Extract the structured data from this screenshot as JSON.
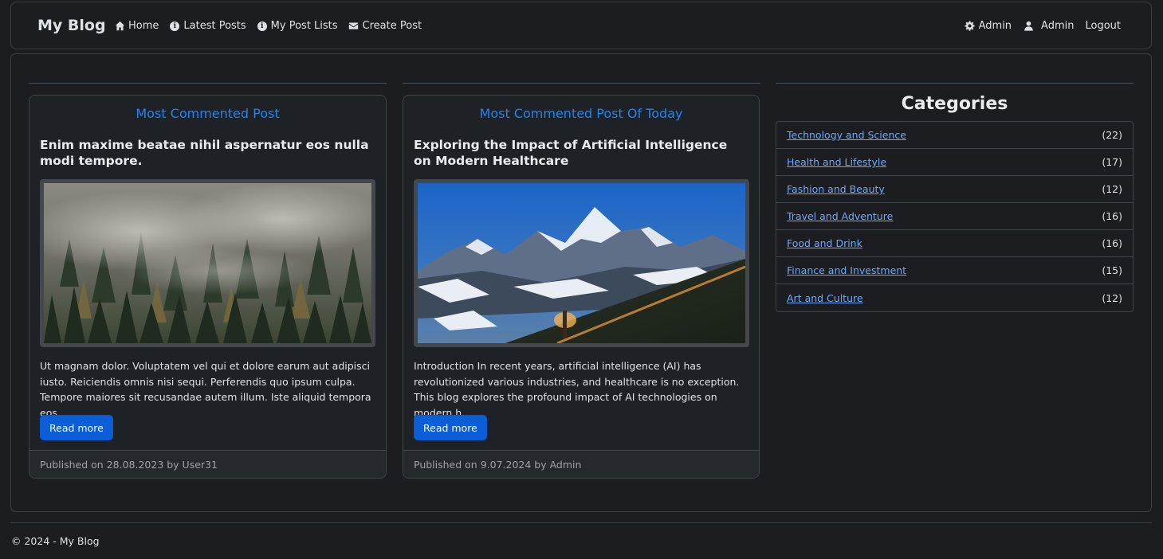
{
  "navbar": {
    "brand": "My Blog",
    "left_links": [
      {
        "label": "Home",
        "icon": "home-icon"
      },
      {
        "label": "Latest Posts",
        "icon": "info-icon"
      },
      {
        "label": "My Post Lists",
        "icon": "info-icon"
      },
      {
        "label": "Create Post",
        "icon": "envelope-icon"
      }
    ],
    "right_links": [
      {
        "label": "Admin",
        "icon": "gear-icon"
      },
      {
        "label": "Admin",
        "icon": "user-icon"
      },
      {
        "label": "Logout"
      }
    ]
  },
  "cards": [
    {
      "heading": "Most Commented Post",
      "title": "Enim maxime beatae nihil aspernatur eos nulla modi tempore.",
      "image": "foggy-forest-image",
      "excerpt": "Ut magnam dolor. Voluptatem vel qui et dolore earum aut adipisci iusto. Reiciendis omnis nisi sequi. Perferendis quo ipsum culpa. Tempore maiores sit recusandae autem illum. Iste aliquid tempora eos ...",
      "button": "Read more",
      "footer": "Published on 28.08.2023 by User31"
    },
    {
      "heading": "Most Commented Post Of Today",
      "title": "Exploring the Impact of Artificial Intelligence on Modern Healthcare",
      "image": "mountain-night-image",
      "excerpt": "Introduction In recent years, artificial intelligence (AI) has revolutionized various industries, and healthcare is no exception. This blog explores the profound impact of AI technologies on modern h...",
      "button": "Read more",
      "footer": "Published on 9.07.2024 by Admin"
    }
  ],
  "categories": {
    "title": "Categories",
    "items": [
      {
        "name": "Technology and Science",
        "count": "(22)"
      },
      {
        "name": "Health and Lifestyle",
        "count": "(17)"
      },
      {
        "name": "Fashion and Beauty",
        "count": "(12)"
      },
      {
        "name": "Travel and Adventure",
        "count": "(16)"
      },
      {
        "name": "Food and Drink",
        "count": "(16)"
      },
      {
        "name": "Finance and Investment",
        "count": "(15)"
      },
      {
        "name": "Art and Culture",
        "count": "(12)"
      }
    ]
  },
  "footer": {
    "text": "© 2024 - My Blog"
  },
  "colors": {
    "background": "#1b1d20",
    "accent_heading": "#1b86f5",
    "button": "#0b5ed7",
    "link": "#6ea8fe"
  }
}
